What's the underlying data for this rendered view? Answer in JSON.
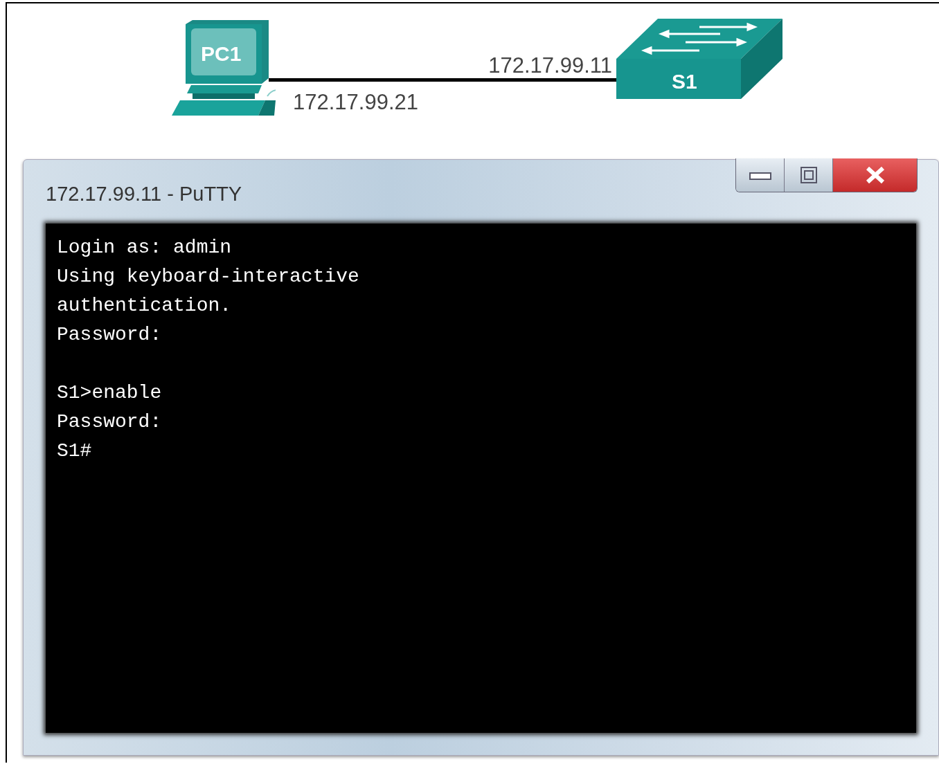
{
  "diagram": {
    "devices": [
      {
        "kind": "pc",
        "name": "PC1",
        "ip": "172.17.99.21"
      },
      {
        "kind": "switch",
        "name": "S1",
        "ip": "172.17.99.11"
      }
    ]
  },
  "window": {
    "title": "172.17.99.11 - PuTTY"
  },
  "terminal": {
    "blocks": [
      [
        "Login as: admin",
        "Using keyboard-interactive",
        "authentication.",
        "Password:"
      ],
      [
        "S1>enable",
        "Password:",
        "S1#"
      ]
    ]
  }
}
